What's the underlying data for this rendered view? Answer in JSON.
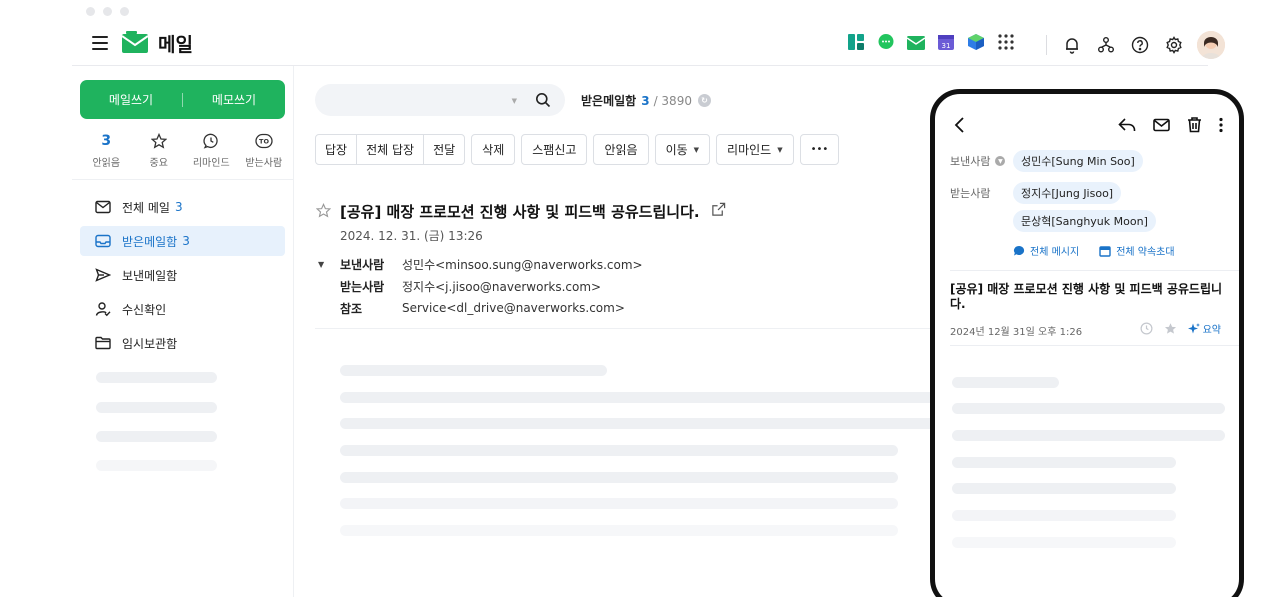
{
  "app": {
    "title": "메일"
  },
  "sidebar": {
    "compose_label": "메일쓰기",
    "memo_label": "메모쓰기",
    "quick": [
      {
        "label": "안읽음",
        "count": "3"
      },
      {
        "label": "중요"
      },
      {
        "label": "리마인드"
      },
      {
        "label": "받는사람"
      }
    ],
    "folders": [
      {
        "label": "전체 메일",
        "count": "3"
      },
      {
        "label": "받은메일함",
        "count": "3"
      },
      {
        "label": "보낸메일함"
      },
      {
        "label": "수신확인"
      },
      {
        "label": "임시보관함"
      }
    ]
  },
  "inbox": {
    "title": "받은메일함",
    "unread": "3",
    "total": "/ 3890"
  },
  "toolbar": {
    "reply": "답장",
    "reply_all": "전체 답장",
    "forward": "전달",
    "delete": "삭제",
    "spam": "스팸신고",
    "unread": "안읽음",
    "move": "이동",
    "remind": "리마인드",
    "more": "•••"
  },
  "mail": {
    "subject": "[공유] 매장 프로모션 진행 사항 및 피드백 공유드립니다.",
    "date": "2024. 12. 31. (금) 13:26",
    "from_label": "보낸사람",
    "from": "성민수<minsoo.sung@naverworks.com>",
    "to_label": "받는사람",
    "to": "정지수<j.jisoo@naverworks.com>",
    "cc_label": "참조",
    "cc": "Service<dl_drive@naverworks.com>"
  },
  "phone": {
    "from_label": "보낸사람",
    "from_chip": "성민수[Sung Min Soo]",
    "to_label": "받는사람",
    "to_chips": [
      "정지수[Jung Jisoo]",
      "문상혁[Sanghyuk Moon]"
    ],
    "all_messages": "전체 메시지",
    "all_invite": "전체 약속초대",
    "subject": "[공유] 매장 프로모션 진행 사항 및 피드백 공유드립니다.",
    "date": "2024년 12월 31일 오후 1:26",
    "summary": "요약"
  },
  "colors": {
    "brand_green": "#1fb35e",
    "accent_blue": "#1a73c8",
    "active_bg": "#e7f1fc"
  }
}
